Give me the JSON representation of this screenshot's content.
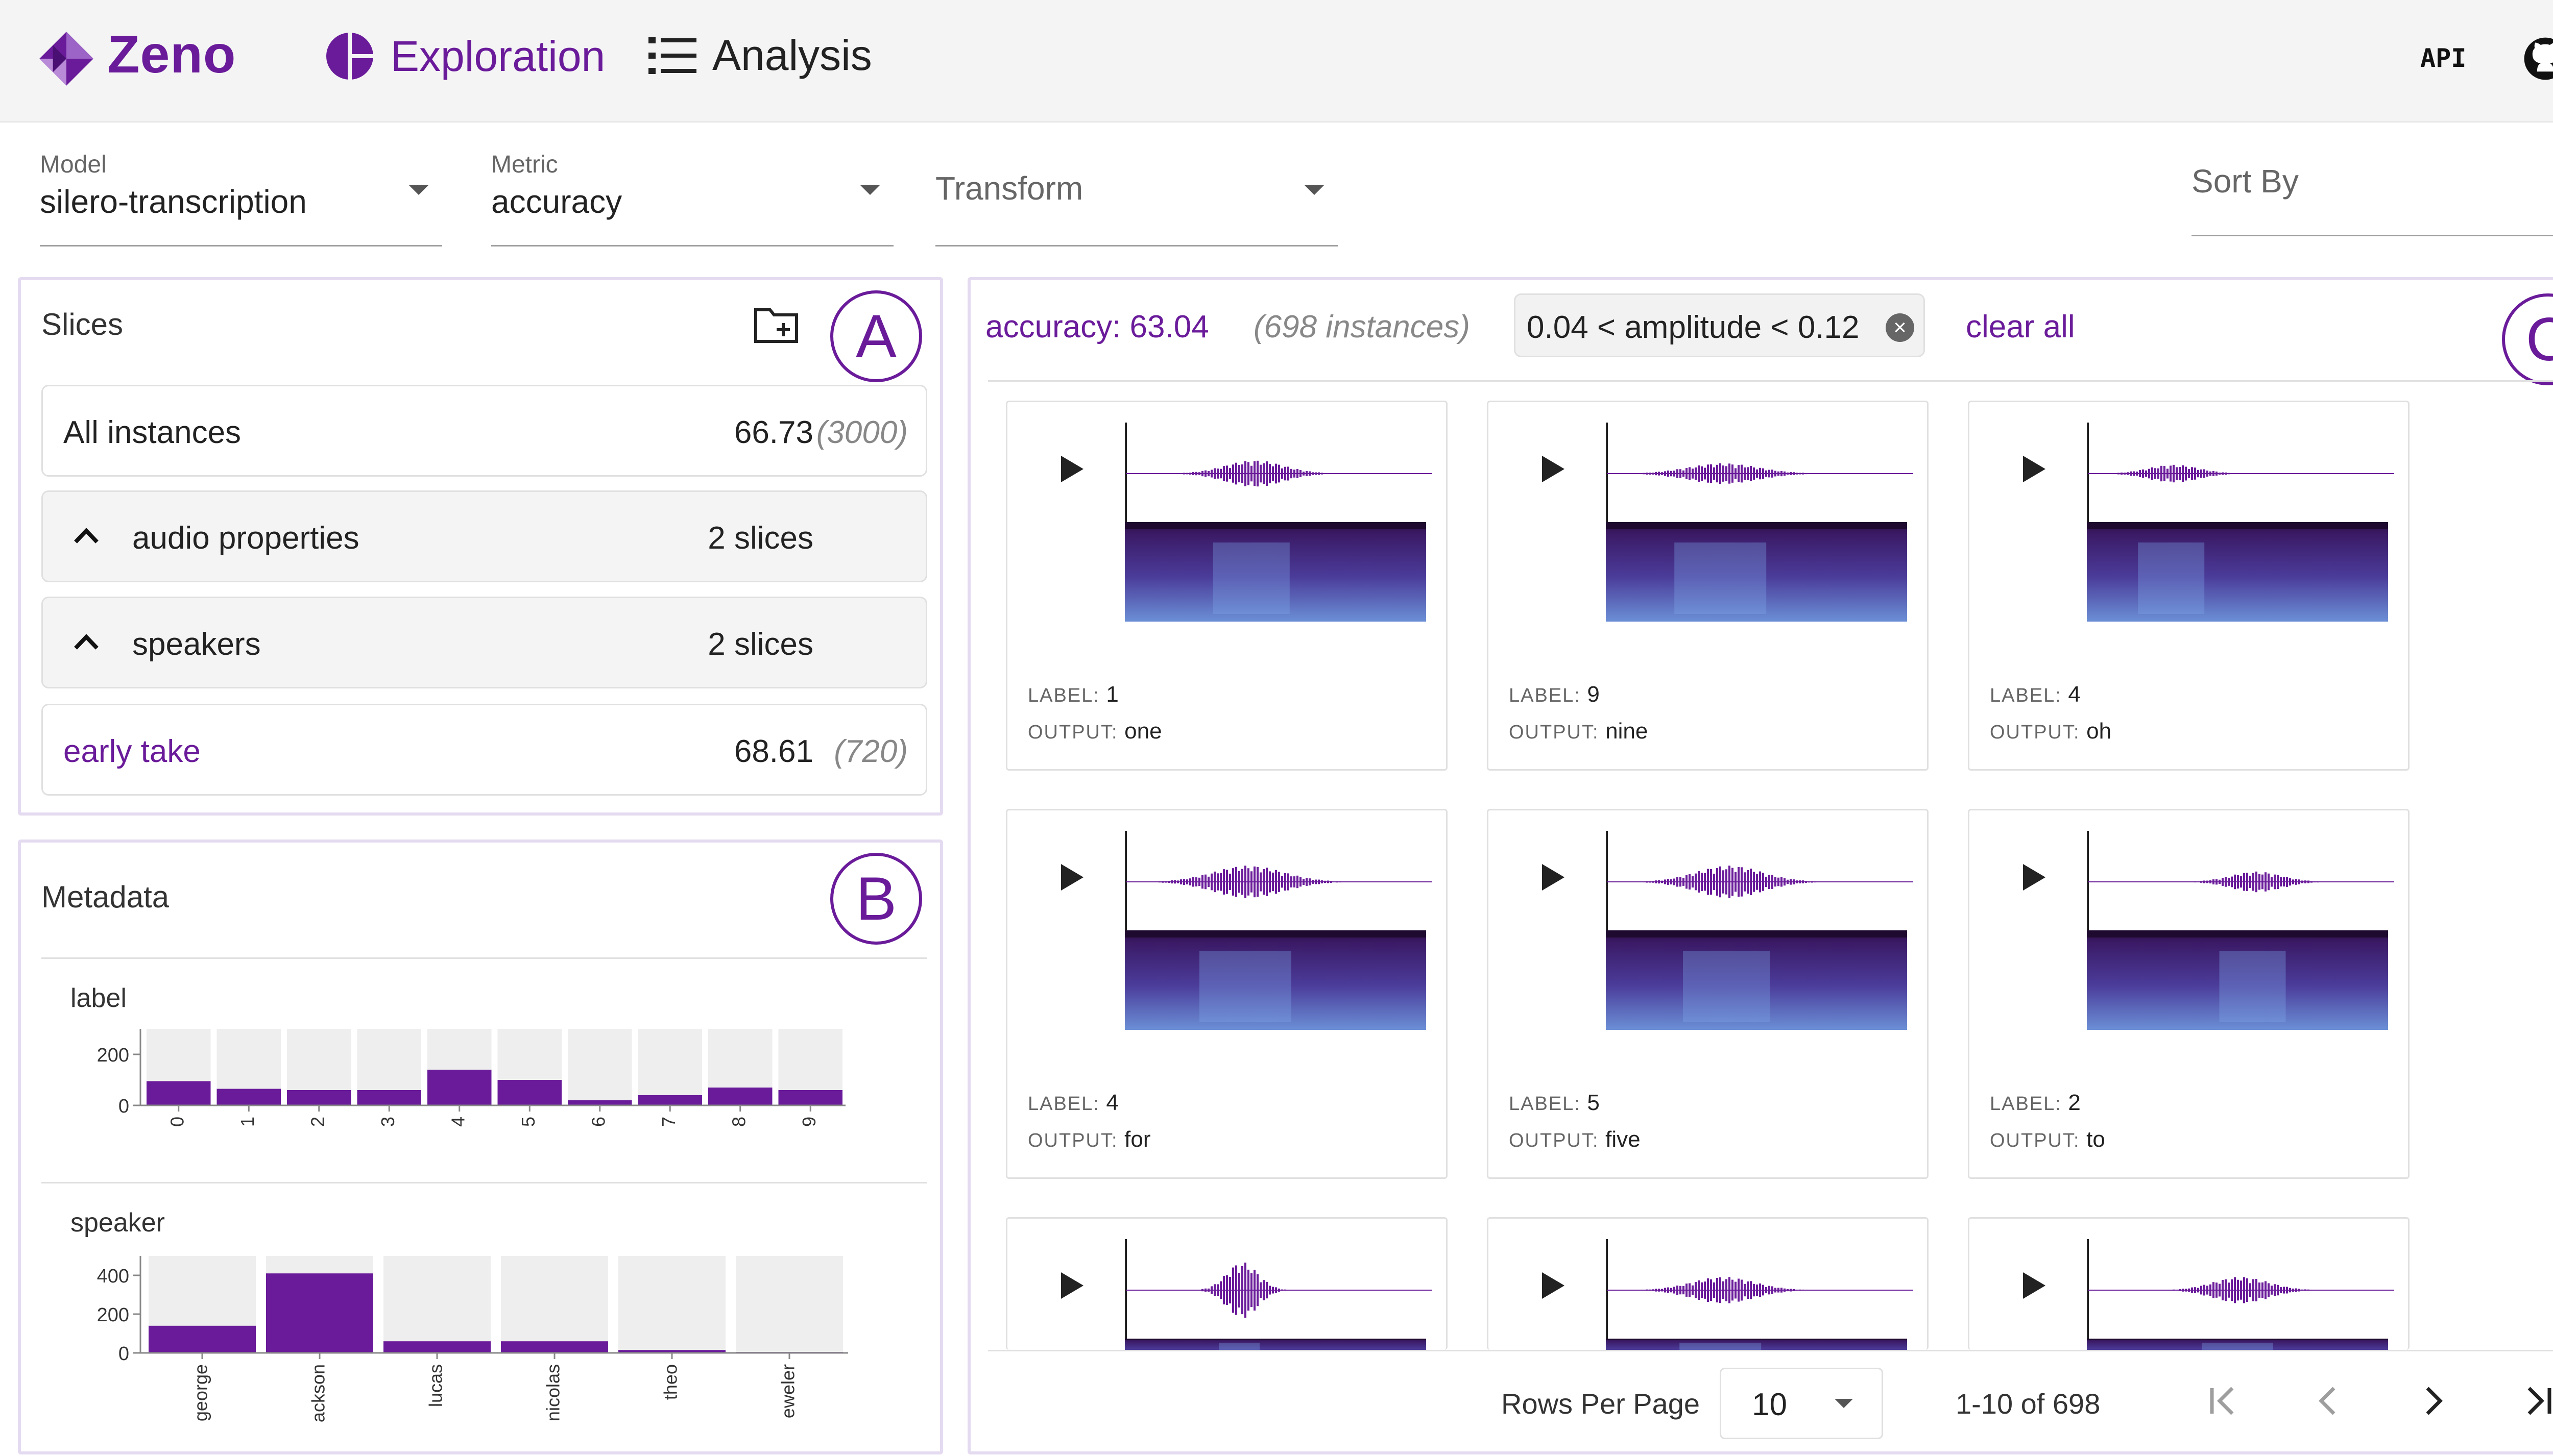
{
  "app": {
    "name": "Zeno"
  },
  "nav": {
    "exploration": "Exploration",
    "analysis": "Analysis",
    "api": "API"
  },
  "selectors": {
    "model": {
      "caption": "Model",
      "value": "silero-transcription"
    },
    "metric": {
      "caption": "Metric",
      "value": "accuracy"
    },
    "transform": {
      "placeholder": "Transform"
    },
    "sort": {
      "placeholder": "Sort By"
    }
  },
  "slices": {
    "title": "Slices",
    "panel_marker": "A",
    "all": {
      "name": "All instances",
      "value": "66.73",
      "count": "(3000)"
    },
    "groups": [
      {
        "name": "audio properties",
        "count": "2 slices"
      },
      {
        "name": "speakers",
        "count": "2 slices"
      }
    ],
    "custom": {
      "name": "early take",
      "value": "68.61",
      "count": "(720)"
    }
  },
  "metadata": {
    "title": "Metadata",
    "panel_marker": "B",
    "charts_yticks": {
      "label": [
        "200",
        "0"
      ],
      "speaker": [
        "400",
        "200",
        "0"
      ]
    }
  },
  "chart_data": [
    {
      "type": "bar",
      "title": "label",
      "categories": [
        "0",
        "1",
        "2",
        "3",
        "4",
        "5",
        "6",
        "7",
        "8",
        "9"
      ],
      "series": [
        {
          "values": [
            95,
            65,
            60,
            60,
            140,
            100,
            20,
            40,
            70,
            60
          ]
        },
        {
          "values": [
            300,
            300,
            300,
            300,
            300,
            300,
            300,
            300,
            300,
            300
          ]
        }
      ],
      "ylim": [
        0,
        300
      ],
      "colors": {
        "filtered": "#6a1b9a",
        "total": "#eeeeee"
      }
    },
    {
      "type": "bar",
      "title": "speaker",
      "categories": [
        "george",
        "ackson",
        "lucas",
        "nicolas",
        "theo",
        "eweler"
      ],
      "series": [
        {
          "values": [
            140,
            410,
            60,
            60,
            15,
            5
          ]
        },
        {
          "values": [
            500,
            500,
            500,
            500,
            500,
            500
          ]
        }
      ],
      "ylim": [
        0,
        500
      ],
      "colors": {
        "filtered": "#6a1b9a",
        "total": "#eeeeee"
      }
    }
  ],
  "instances": {
    "panel_marker": "C",
    "metric_text": "accuracy: 63.04",
    "count_text": "(698 instances)",
    "filter_text": "0.04 < amplitude < 0.12",
    "clear_all": "clear all",
    "label_key": "LABEL:",
    "output_key": "OUTPUT:",
    "cards": [
      {
        "label": "1",
        "output": "one"
      },
      {
        "label": "9",
        "output": "nine"
      },
      {
        "label": "4",
        "output": "oh"
      },
      {
        "label": "4",
        "output": "for"
      },
      {
        "label": "5",
        "output": "five"
      },
      {
        "label": "2",
        "output": "to"
      },
      {
        "label": "",
        "output": ""
      },
      {
        "label": "",
        "output": ""
      },
      {
        "label": "",
        "output": ""
      }
    ]
  },
  "pagination": {
    "rows_label": "Rows Per Page",
    "rows_value": "10",
    "range": "1-10 of 698"
  },
  "colors": {
    "accent": "#6a1b9a",
    "panel_border": "#e4dbf1"
  }
}
